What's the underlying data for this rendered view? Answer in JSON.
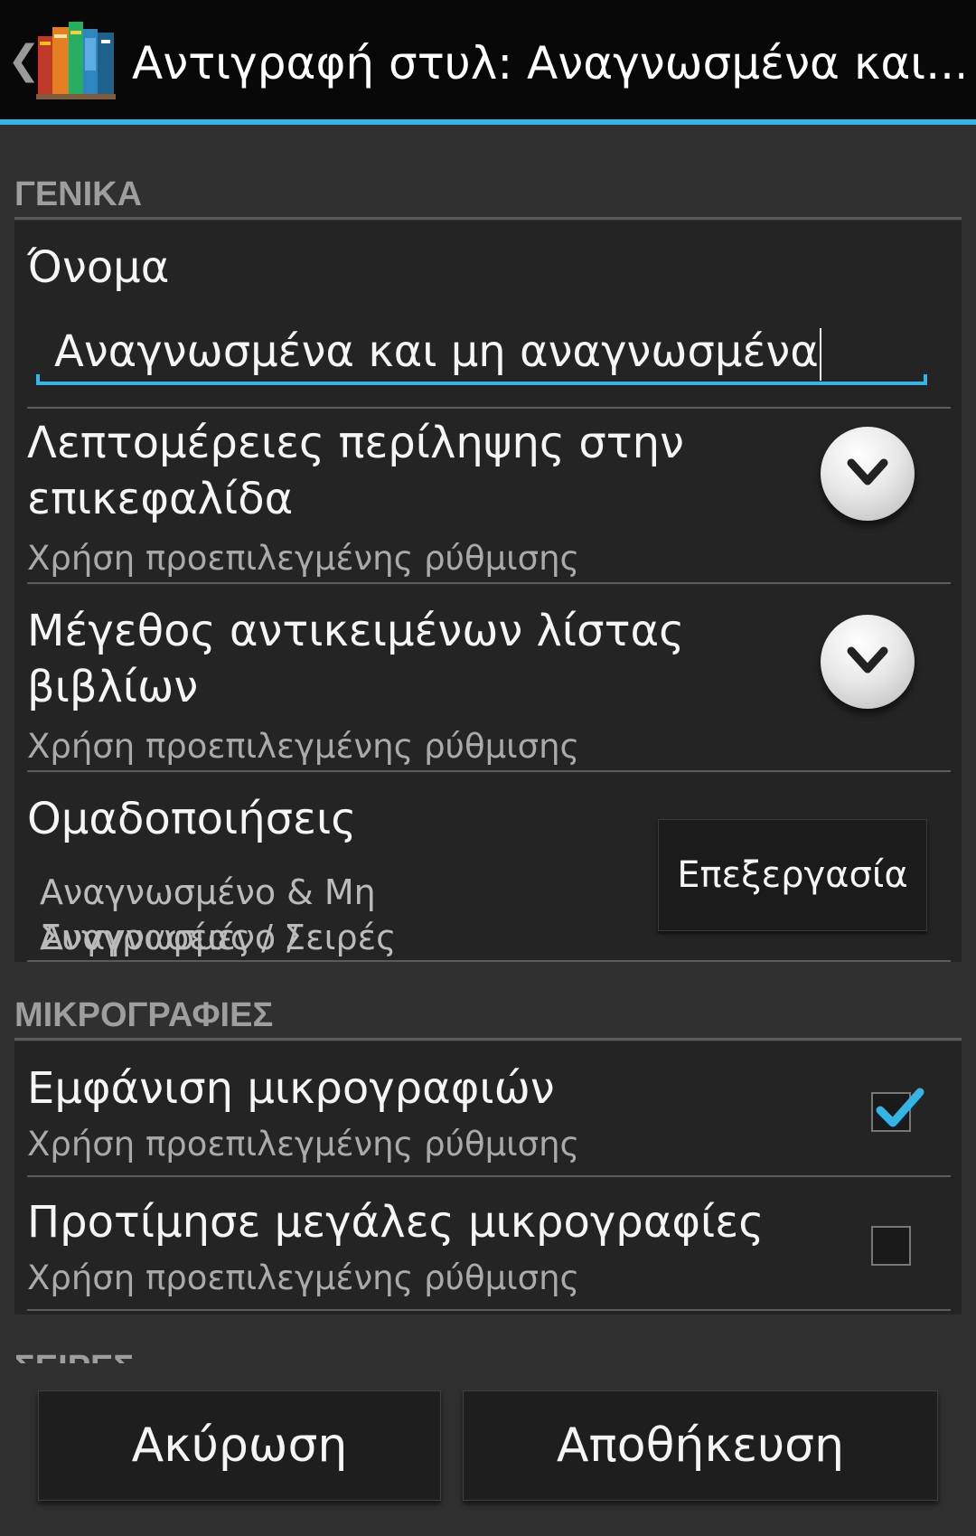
{
  "action_bar": {
    "back_icon": "chevron-left-icon",
    "app_icon": "books-icon",
    "title": "Αντιγραφή στυλ: Αναγνωσμένα και..."
  },
  "sections": {
    "general": {
      "header": "ΓΕΝΙΚΑ",
      "name_label": "Όνομα",
      "name_value": "Αναγνωσμένα και μη αναγνωσμένα",
      "summary_details": {
        "title_line1": "Λεπτομέρειες περίληψης στην",
        "title_line2": "επικεφαλίδα",
        "summary": "Χρήση προεπιλεγμένης ρύθμισης"
      },
      "list_item_size": {
        "title_line1": "Μέγεθος αντικειμένων λίστας",
        "title_line2": "βιβλίων",
        "summary": "Χρήση προεπιλεγμένης ρύθμισης"
      },
      "groupings": {
        "title": "Ομαδοποιήσεις",
        "summary_line1": "Αναγνωσμένο & Μη Αναγνωσμένο /",
        "summary_line2": "Συγγραφέας / Σειρές",
        "edit_label": "Επεξεργασία"
      }
    },
    "thumbnails": {
      "header": "ΜΙΚΡΟΓΡΑΦΙΕΣ",
      "show_thumbnails": {
        "title": "Εμφάνιση μικρογραφιών",
        "summary": "Χρήση προεπιλεγμένης ρύθμισης",
        "checked": true
      },
      "prefer_large": {
        "title": "Προτίμησε μεγάλες μικρογραφίες",
        "summary": "Χρήση προεπιλεγμένης ρύθμισης",
        "checked": false
      }
    },
    "series": {
      "header": "ΣΕΙΡΕΣ"
    }
  },
  "buttons": {
    "cancel": "Ακύρωση",
    "save": "Αποθήκευση"
  },
  "colors": {
    "accent": "#33b5e5",
    "background": "#303030",
    "card": "#242424"
  }
}
